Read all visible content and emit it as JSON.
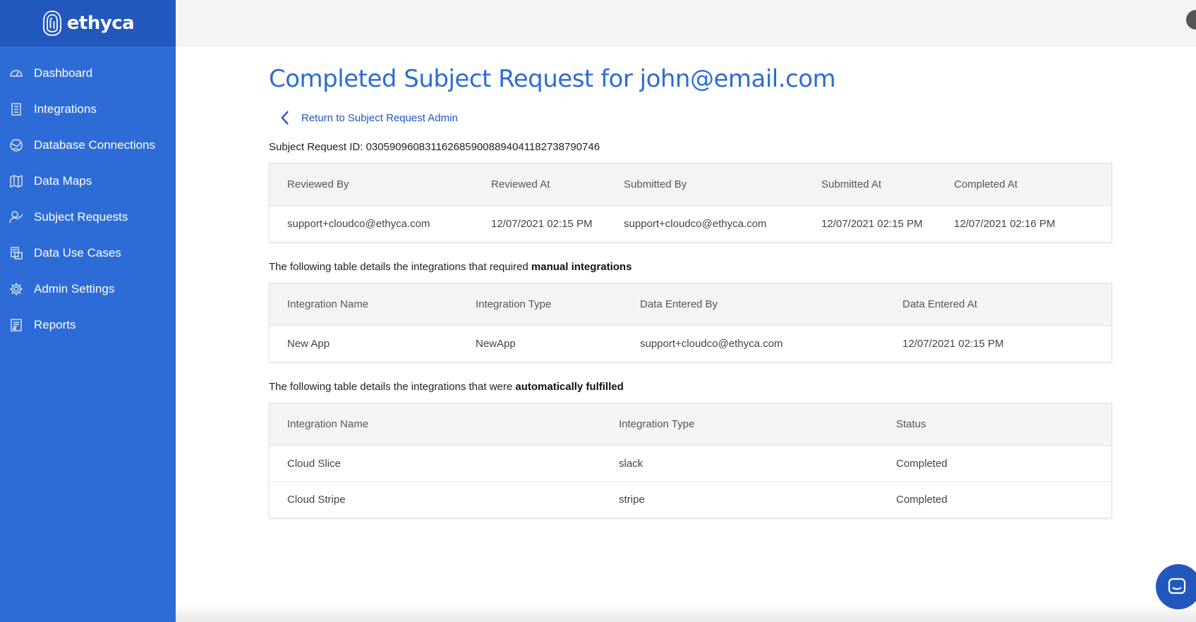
{
  "brand": {
    "name": "ethyca"
  },
  "sidebar": {
    "items": [
      {
        "label": "Dashboard",
        "icon": "dashboard-gauge-icon"
      },
      {
        "label": "Integrations",
        "icon": "integrations-doc-icon"
      },
      {
        "label": "Database Connections",
        "icon": "database-globe-icon"
      },
      {
        "label": "Data Maps",
        "icon": "data-map-icon"
      },
      {
        "label": "Subject Requests",
        "icon": "user-check-icon"
      },
      {
        "label": "Data Use Cases",
        "icon": "use-cases-icon"
      },
      {
        "label": "Admin Settings",
        "icon": "gear-icon"
      },
      {
        "label": "Reports",
        "icon": "report-icon"
      }
    ]
  },
  "page": {
    "title": "Completed Subject Request for john@email.com",
    "back_link": "Return to Subject Request Admin",
    "request_id_label": "Subject Request ID:",
    "request_id": "0305909608311626859008894041182738790746"
  },
  "review_table": {
    "headers": [
      "Reviewed By",
      "Reviewed At",
      "Submitted By",
      "Submitted At",
      "Completed At"
    ],
    "rows": [
      [
        "support+cloudco@ethyca.com",
        "12/07/2021 02:15 PM",
        "support+cloudco@ethyca.com",
        "12/07/2021 02:15 PM",
        "12/07/2021 02:16 PM"
      ]
    ]
  },
  "manual_section": {
    "text": "The following table details the integrations that required",
    "bold": "manual integrations"
  },
  "manual_table": {
    "headers": [
      "Integration Name",
      "Integration Type",
      "Data Entered By",
      "Data Entered At"
    ],
    "rows": [
      [
        "New App",
        "NewApp",
        "support+cloudco@ethyca.com",
        "12/07/2021 02:15 PM"
      ]
    ]
  },
  "auto_section": {
    "text": "The following table details the integrations that were",
    "bold": "automatically fulfilled"
  },
  "auto_table": {
    "headers": [
      "Integration Name",
      "Integration Type",
      "Status"
    ],
    "rows": [
      [
        "Cloud Slice",
        "slack",
        "Completed"
      ],
      [
        "Cloud Stripe",
        "stripe",
        "Completed"
      ]
    ]
  },
  "colors": {
    "sidebar": "#2d6cd6",
    "sidebar_header": "#2257bd",
    "accent": "#2d6cd6",
    "table_header_bg": "#f4f4f4"
  },
  "chat_widget": {
    "icon": "chat-bubble-icon"
  }
}
